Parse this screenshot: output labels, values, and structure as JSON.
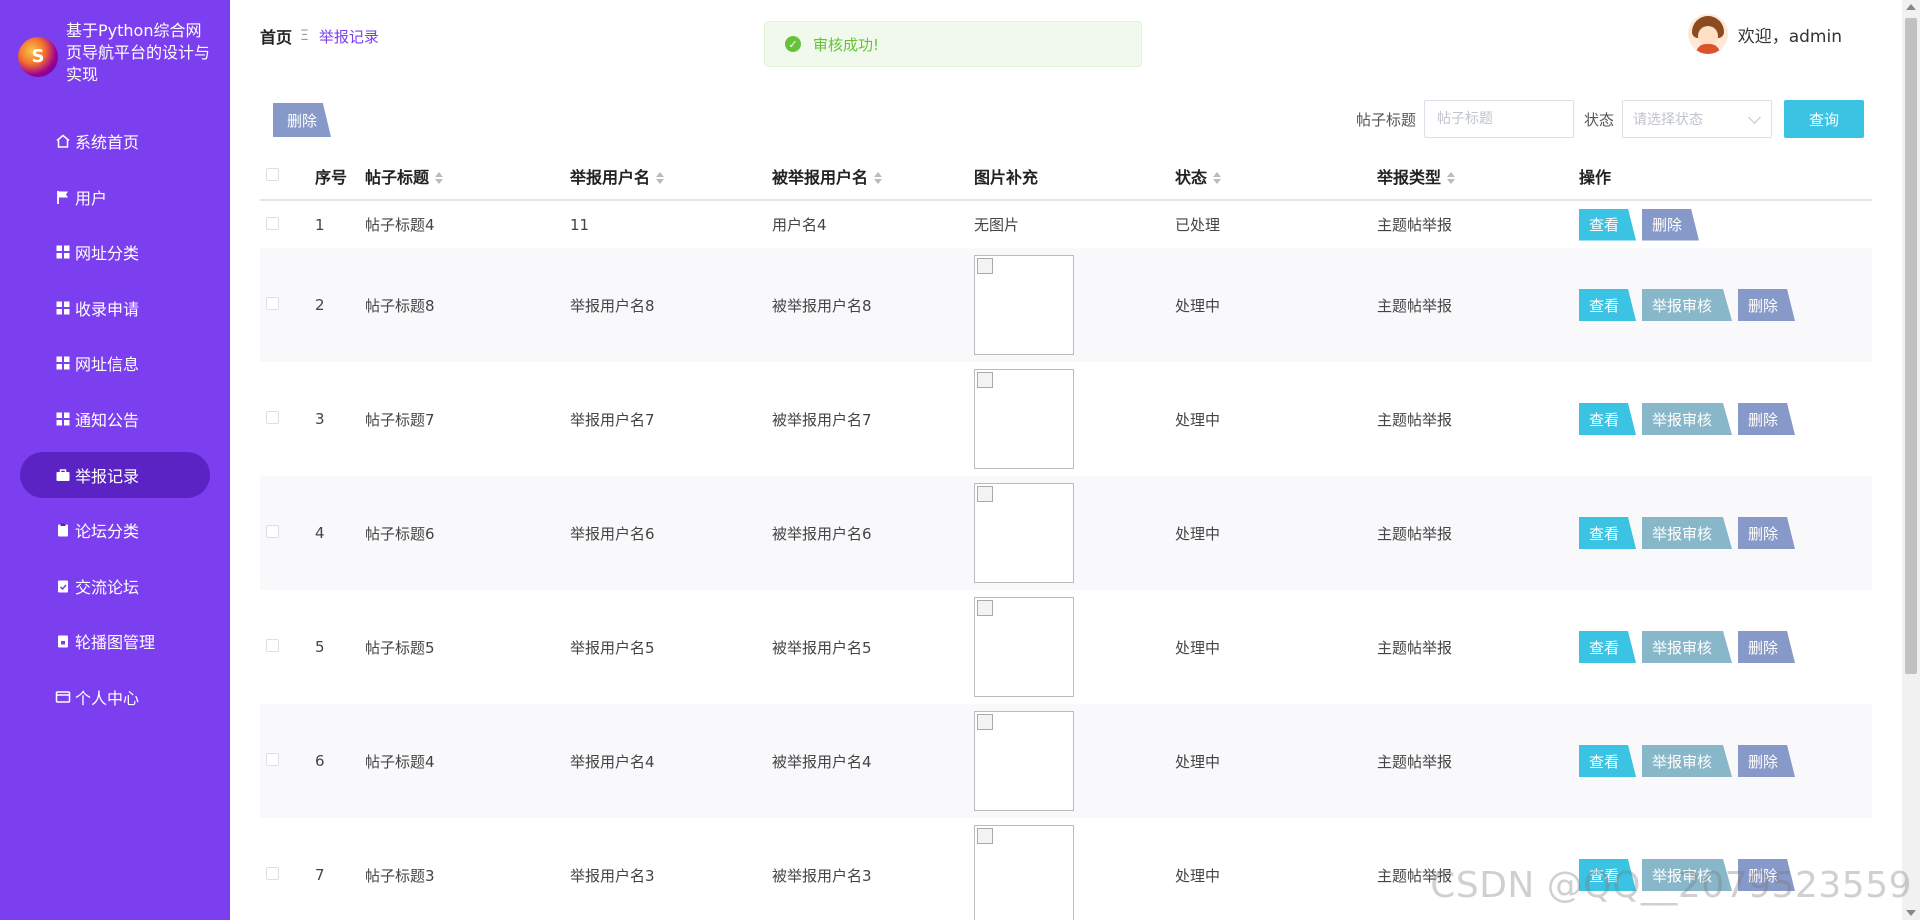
{
  "sidebar": {
    "brand_title": "基于Python综合网页导航平台的设计与实现",
    "items": [
      {
        "label": "系统首页",
        "icon": "home-icon"
      },
      {
        "label": "用户",
        "icon": "flag-icon"
      },
      {
        "label": "网址分类",
        "icon": "grid-icon"
      },
      {
        "label": "收录申请",
        "icon": "grid-icon"
      },
      {
        "label": "网址信息",
        "icon": "grid-icon"
      },
      {
        "label": "通知公告",
        "icon": "grid-icon"
      },
      {
        "label": "举报记录",
        "icon": "briefcase-icon",
        "active": true
      },
      {
        "label": "论坛分类",
        "icon": "clipboard-icon"
      },
      {
        "label": "交流论坛",
        "icon": "clipboard-check-icon"
      },
      {
        "label": "轮播图管理",
        "icon": "clipboard-lock-icon"
      },
      {
        "label": "个人中心",
        "icon": "id-card-icon"
      }
    ]
  },
  "breadcrumb": {
    "home": "首页",
    "separator": "Ξ",
    "current": "举报记录"
  },
  "toast": {
    "message": "审核成功!",
    "color": "#67c23a"
  },
  "user": {
    "greeting": "欢迎，admin"
  },
  "toolbar": {
    "delete_label": "删除",
    "title_label": "帖子标题",
    "title_placeholder": "帖子标题",
    "status_label": "状态",
    "status_placeholder": "请选择状态",
    "query_label": "查询"
  },
  "table": {
    "headers": [
      "序号",
      "帖子标题",
      "举报用户名",
      "被举报用户名",
      "图片补充",
      "状态",
      "举报类型",
      "操作"
    ],
    "rows": [
      {
        "no": "1",
        "title": "帖子标题4",
        "reporter": "11",
        "reported": "用户名4",
        "image": "无图片",
        "status": "已处理",
        "type": "主题帖举报",
        "actions": [
          "查看",
          "删除"
        ]
      },
      {
        "no": "2",
        "title": "帖子标题8",
        "reporter": "举报用户名8",
        "reported": "被举报用户名8",
        "image": "",
        "status": "处理中",
        "type": "主题帖举报",
        "actions": [
          "查看",
          "举报审核",
          "删除"
        ]
      },
      {
        "no": "3",
        "title": "帖子标题7",
        "reporter": "举报用户名7",
        "reported": "被举报用户名7",
        "image": "",
        "status": "处理中",
        "type": "主题帖举报",
        "actions": [
          "查看",
          "举报审核",
          "删除"
        ]
      },
      {
        "no": "4",
        "title": "帖子标题6",
        "reporter": "举报用户名6",
        "reported": "被举报用户名6",
        "image": "",
        "status": "处理中",
        "type": "主题帖举报",
        "actions": [
          "查看",
          "举报审核",
          "删除"
        ]
      },
      {
        "no": "5",
        "title": "帖子标题5",
        "reporter": "举报用户名5",
        "reported": "被举报用户名5",
        "image": "",
        "status": "处理中",
        "type": "主题帖举报",
        "actions": [
          "查看",
          "举报审核",
          "删除"
        ]
      },
      {
        "no": "6",
        "title": "帖子标题4",
        "reporter": "举报用户名4",
        "reported": "被举报用户名4",
        "image": "",
        "status": "处理中",
        "type": "主题帖举报",
        "actions": [
          "查看",
          "举报审核",
          "删除"
        ]
      },
      {
        "no": "7",
        "title": "帖子标题3",
        "reporter": "举报用户名3",
        "reported": "被举报用户名3",
        "image": "",
        "status": "处理中",
        "type": "主题帖举报",
        "actions": [
          "查看",
          "举报审核",
          "删除"
        ]
      }
    ]
  },
  "watermark": "CSDN @QQ__2079523559",
  "colors": {
    "sidebar": "#7b3ff0",
    "sidebar_active": "#5b23c4",
    "view_btn": "#3bc3e3",
    "audit_btn": "#88b7c9",
    "delete_btn": "#8799c8"
  }
}
